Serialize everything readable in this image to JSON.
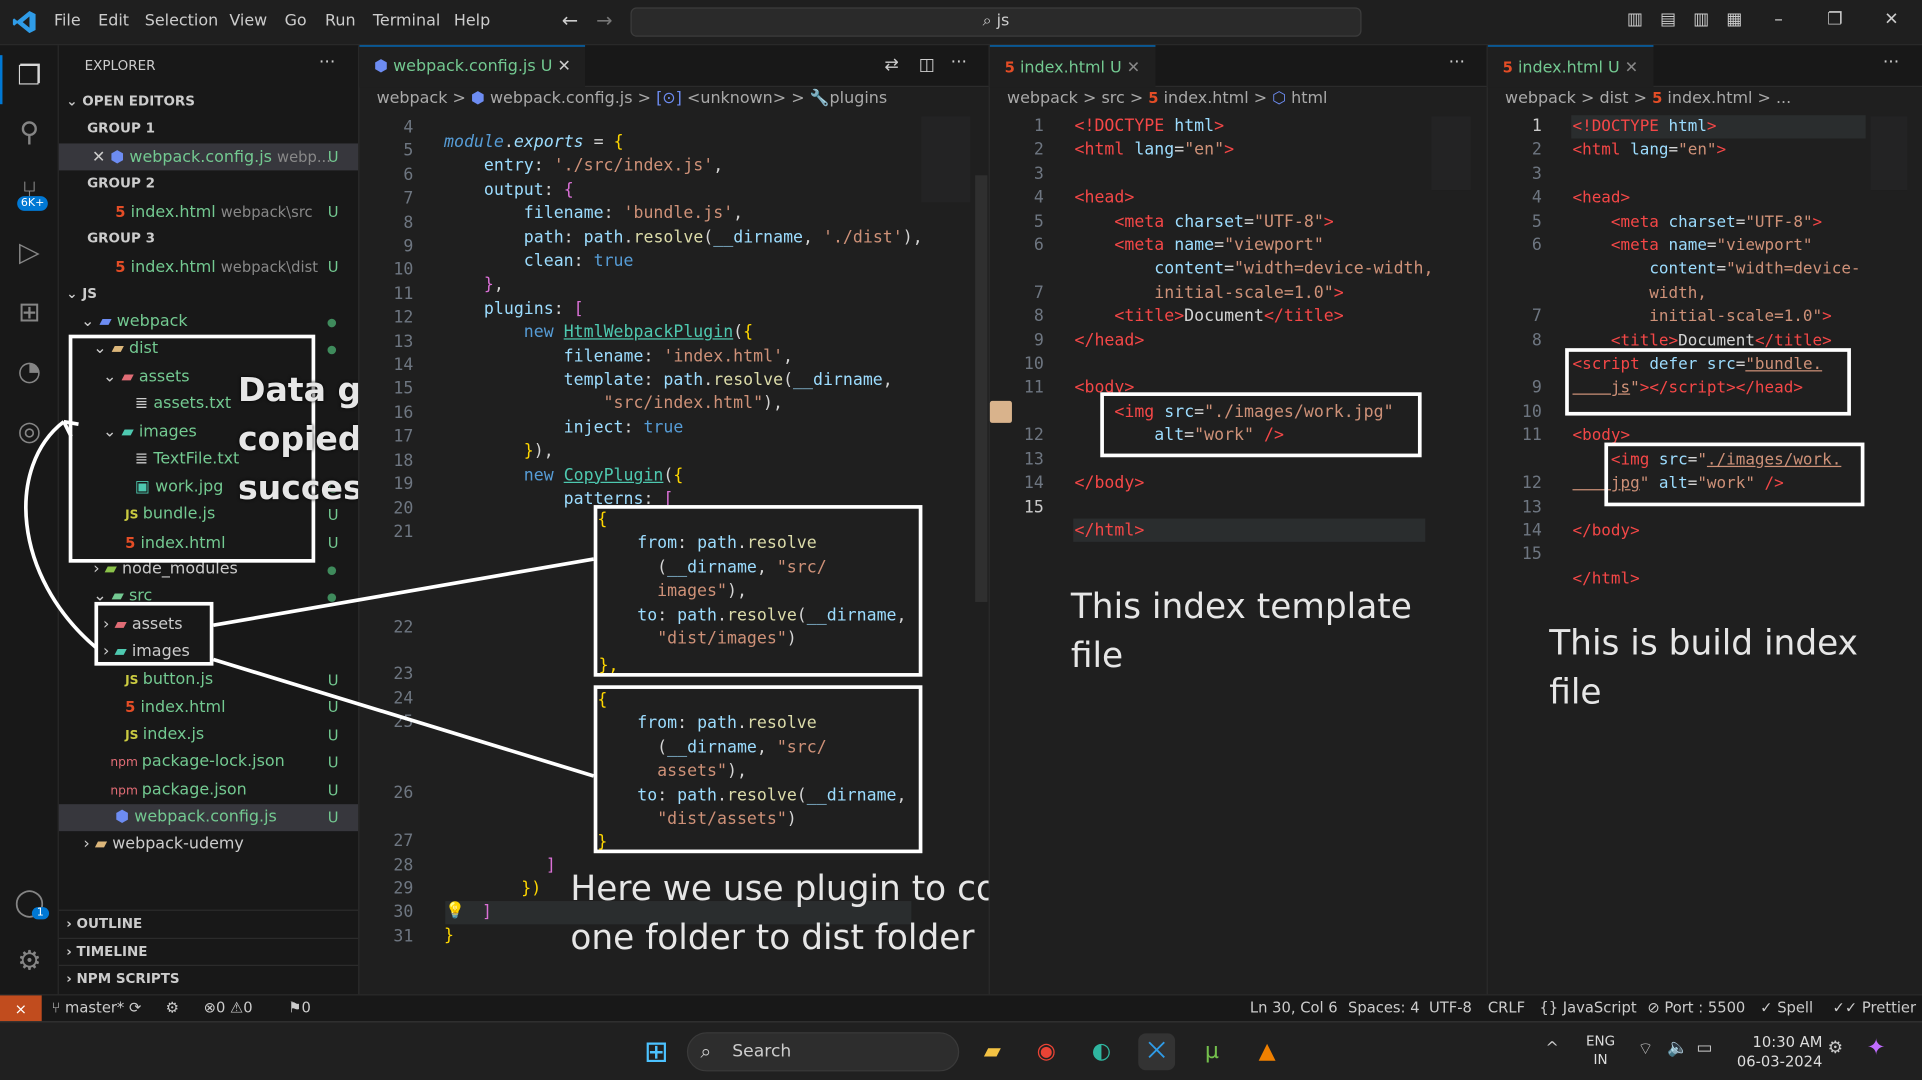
{
  "menu": [
    "File",
    "Edit",
    "Selection",
    "View",
    "Go",
    "Run",
    "Terminal",
    "Help"
  ],
  "command_center": "js",
  "explorer": {
    "title": "EXPLORER",
    "open_editors": "OPEN EDITORS",
    "group1": "GROUP 1",
    "group2": "GROUP 2",
    "group3": "GROUP 3",
    "oe1_name": "webpack.config.js",
    "oe1_path": "webp...",
    "oe2_name": "index.html",
    "oe2_path": "webpack\\src",
    "oe3_name": "index.html",
    "oe3_path": "webpack\\dist",
    "workspace": "JS",
    "tree": {
      "webpack": "webpack",
      "dist": "dist",
      "assets": "assets",
      "assets_txt": "assets.txt",
      "images": "images",
      "textfile": "TextFile.txt",
      "workjpg": "work.jpg",
      "bundle": "bundle.js",
      "dist_index": "index.html",
      "node_modules": "node_modules",
      "src": "src",
      "src_assets": "assets",
      "src_images": "images",
      "button": "button.js",
      "src_index": "index.html",
      "indexjs": "index.js",
      "pkglock": "package-lock.json",
      "pkg": "package.json",
      "config": "webpack.config.js",
      "udemy": "webpack-udemy"
    },
    "u": "U",
    "outline": "OUTLINE",
    "timeline": "TIMELINE",
    "npm": "NPM SCRIPTS"
  },
  "badges": {
    "scm": "6K+",
    "account": "1"
  },
  "editor1": {
    "tab": "webpack.config.js",
    "tab_u": "U",
    "crumb": [
      "webpack",
      ">",
      "webpack.config.js",
      ">",
      "<unknown>",
      ">",
      "plugins"
    ]
  },
  "editor2": {
    "tab": "index.html",
    "tab_u": "U",
    "crumb": [
      "webpack",
      ">",
      "src",
      ">",
      "index.html",
      ">",
      "html"
    ]
  },
  "editor3": {
    "tab": "index.html",
    "tab_u": "U",
    "crumb": [
      "webpack",
      ">",
      "dist",
      ">",
      "index.html",
      ">",
      "..."
    ]
  },
  "annotations": {
    "copied": "Data get copied successfully",
    "plugin": "Here we use plugin to copy data from one folder to dist folder",
    "template": "This index template file",
    "build": "This is build index file"
  },
  "status": {
    "branch": "master*",
    "errors": "0",
    "warnings": "0",
    "ports": "0",
    "position": "Ln 30, Col 6",
    "spaces": "Spaces: 4",
    "encoding": "UTF-8",
    "eol": "CRLF",
    "language": "JavaScript",
    "port": "Port : 5500",
    "spell": "Spell",
    "prettier": "Prettier"
  },
  "taskbar": {
    "search": "Search",
    "lang1": "ENG",
    "lang2": "IN",
    "time": "10:30 AM",
    "date": "06-03-2024"
  }
}
